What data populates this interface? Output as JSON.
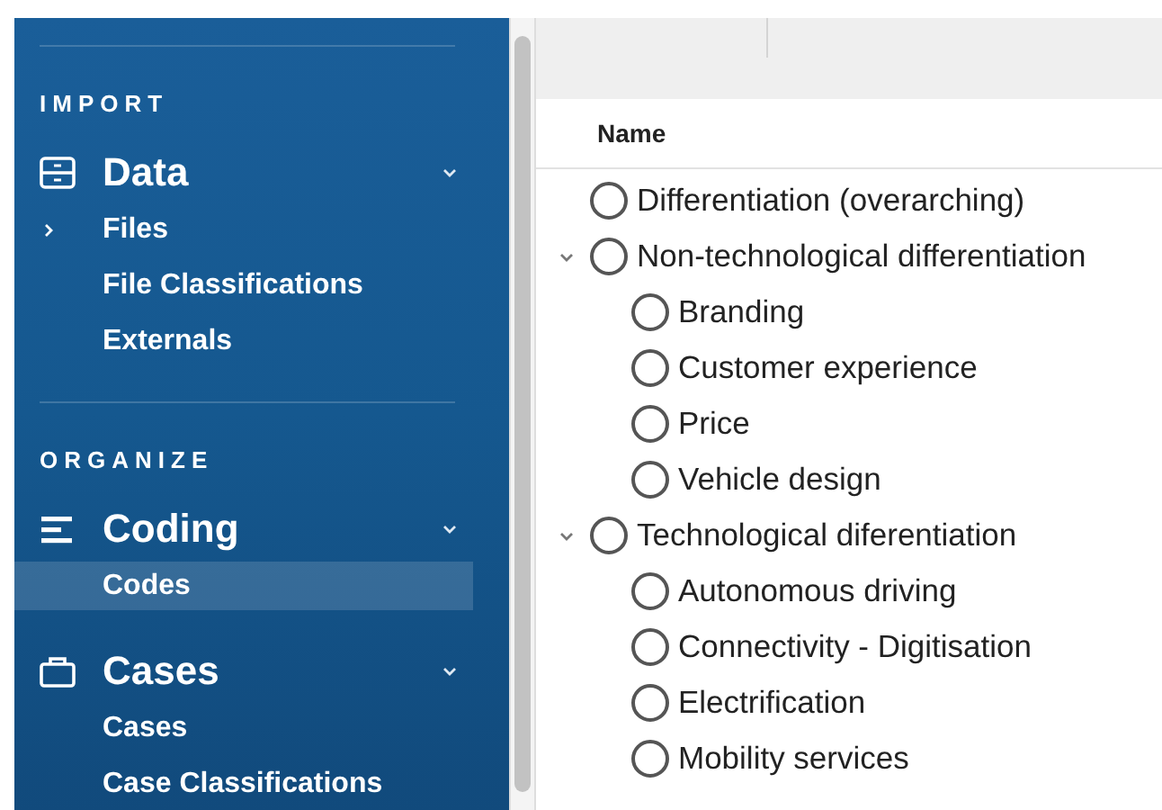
{
  "sidebar": {
    "sections": [
      {
        "label": "IMPORT",
        "groups": [
          {
            "title": "Data",
            "kind": "drawer",
            "expanded": true,
            "items": [
              {
                "label": "Files",
                "selected": false,
                "expandable": true
              },
              {
                "label": "File Classifications",
                "selected": false,
                "expandable": false
              },
              {
                "label": "Externals",
                "selected": false,
                "expandable": false
              }
            ]
          }
        ]
      },
      {
        "label": "ORGANIZE",
        "groups": [
          {
            "title": "Coding",
            "kind": "lines",
            "expanded": true,
            "items": [
              {
                "label": "Codes",
                "selected": true,
                "expandable": false
              }
            ]
          },
          {
            "title": "Cases",
            "kind": "briefcase",
            "expanded": true,
            "items": [
              {
                "label": "Cases",
                "selected": false,
                "expandable": false
              },
              {
                "label": "Case Classifications",
                "selected": false,
                "expandable": false
              }
            ]
          }
        ]
      }
    ]
  },
  "table": {
    "columns": [
      "Name"
    ],
    "nodes": [
      {
        "name": "Differentiation (overarching)"
      },
      {
        "name": "Non-technological differentiation",
        "expanded": true,
        "children": [
          {
            "name": "Branding"
          },
          {
            "name": "Customer experience"
          },
          {
            "name": "Price"
          },
          {
            "name": "Vehicle design"
          }
        ]
      },
      {
        "name": "Technological diferentiation",
        "expanded": true,
        "children": [
          {
            "name": "Autonomous driving"
          },
          {
            "name": "Connectivity - Digitisation"
          },
          {
            "name": "Electrification"
          },
          {
            "name": "Mobility services"
          }
        ]
      }
    ]
  }
}
